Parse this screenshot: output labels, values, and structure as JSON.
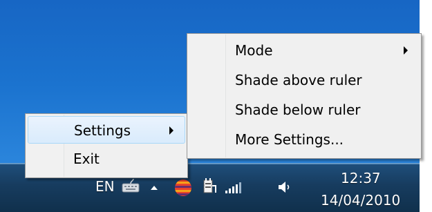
{
  "taskbar": {
    "language": "EN",
    "clock_time": "12:37",
    "clock_date": "14/04/2010",
    "tray_icons": [
      "keyboard-icon",
      "show-hidden-icons-icon",
      "ruler-app-icon",
      "power-icon",
      "network-signal-icon",
      "volume-icon"
    ]
  },
  "tray_menu": {
    "items": [
      {
        "label": "Settings",
        "has_submenu": true,
        "highlighted": true
      },
      {
        "label": "Exit",
        "has_submenu": false,
        "highlighted": false
      }
    ]
  },
  "settings_submenu": {
    "items": [
      {
        "label": "Mode",
        "has_submenu": true
      },
      {
        "label": "Shade above ruler",
        "has_submenu": false
      },
      {
        "label": "Shade below ruler",
        "has_submenu": false
      },
      {
        "label": "More Settings...",
        "has_submenu": false
      }
    ]
  },
  "colors": {
    "desktop": "#1b73cf",
    "taskbar": "#173c5f",
    "menu_background": "#f0f0f0",
    "highlight": "#d9ebfc"
  }
}
